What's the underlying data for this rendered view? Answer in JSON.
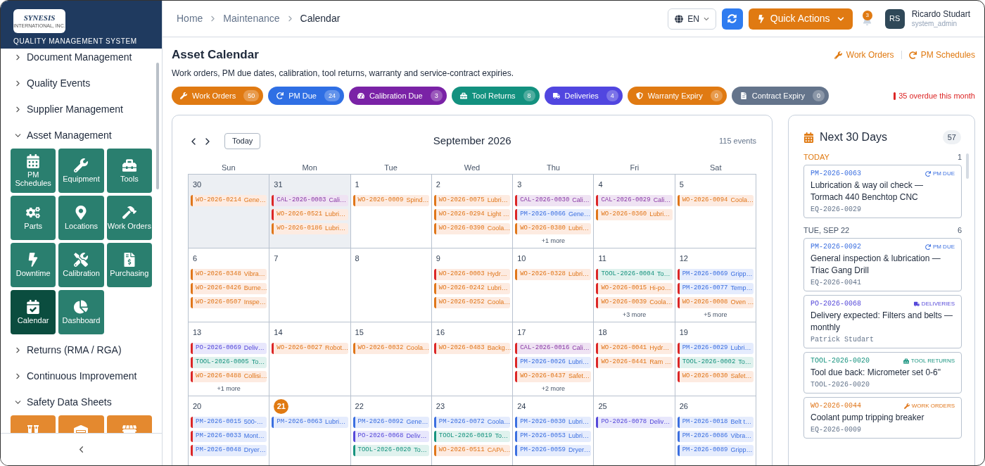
{
  "sidebar": {
    "logo_text": "SYNESIS",
    "logo_subtext": "INTERNATIONAL, INC.",
    "app_title": "QUALITY MANAGEMENT SYSTEM",
    "nav": [
      {
        "label": "Document Management",
        "expanded": false
      },
      {
        "label": "Quality Events",
        "expanded": false
      },
      {
        "label": "Supplier Management",
        "expanded": false
      },
      {
        "label": "Asset Management",
        "expanded": true,
        "tiles": [
          {
            "label": "PM Schedules",
            "selected": false
          },
          {
            "label": "Equipment",
            "selected": false
          },
          {
            "label": "Tools",
            "selected": false
          },
          {
            "label": "Parts",
            "selected": false
          },
          {
            "label": "Locations",
            "selected": false
          },
          {
            "label": "Work Orders",
            "selected": false
          },
          {
            "label": "Downtime",
            "selected": false
          },
          {
            "label": "Calibration",
            "selected": false
          },
          {
            "label": "Purchasing",
            "selected": false
          },
          {
            "label": "Calendar",
            "selected": true
          },
          {
            "label": "Dashboard",
            "selected": false
          }
        ]
      },
      {
        "label": "Returns (RMA / RGA)",
        "expanded": false
      },
      {
        "label": "Continuous Improvement",
        "expanded": false
      },
      {
        "label": "Safety Data Sheets",
        "expanded": true,
        "tiles": [
          {
            "selected": false
          },
          {
            "selected": false
          },
          {
            "selected": false
          }
        ]
      }
    ]
  },
  "topbar": {
    "breadcrumb": [
      "Home",
      "Maintenance",
      "Calendar"
    ],
    "language": "EN",
    "quick_actions": "Quick Actions",
    "notifications": "3",
    "user": {
      "initials": "RS",
      "name": "Ricardo Studart",
      "role": "system_admin"
    }
  },
  "page": {
    "title": "Asset Calendar",
    "description": "Work orders, PM due dates, calibration, tool returns, warranty and service-contract expiries.",
    "links": [
      "Work Orders",
      "PM Schedules"
    ],
    "filters": [
      {
        "label": "Work Orders",
        "count": "50",
        "color": "#e07a12"
      },
      {
        "label": "PM Due",
        "count": "24",
        "color": "#2f6fe4"
      },
      {
        "label": "Calibration Due",
        "count": "3",
        "color": "#7a22a6"
      },
      {
        "label": "Tool Returns",
        "count": "8",
        "color": "#13917f"
      },
      {
        "label": "Deliveries",
        "count": "4",
        "color": "#5146e0"
      },
      {
        "label": "Warranty Expiry",
        "count": "0",
        "color": "#e07a12"
      },
      {
        "label": "Contract Expiry",
        "count": "0",
        "color": "#64748b"
      }
    ],
    "overdue": "35 overdue this month"
  },
  "calendar": {
    "today_button": "Today",
    "month": "September 2026",
    "event_count": "115 events",
    "weekdays": [
      "Sun",
      "Mon",
      "Tue",
      "Wed",
      "Thu",
      "Fri",
      "Sat"
    ],
    "weeks": [
      {
        "days": [
          {
            "day": "30",
            "outside_month": true,
            "today": false,
            "events": [
              {
                "code": "WO-2026-0214",
                "title": "Gene…",
                "kind": "wo",
                "overdue": false
              }
            ]
          },
          {
            "day": "31",
            "outside_month": true,
            "today": false,
            "events": [
              {
                "code": "CAL-2026-0003",
                "title": "Cali…",
                "kind": "cal",
                "overdue": true
              },
              {
                "code": "WO-2026-0521",
                "title": "Lubri…",
                "kind": "wo",
                "overdue": true
              },
              {
                "code": "WO-2026-0186",
                "title": "Lubri…",
                "kind": "wo",
                "overdue": false
              }
            ]
          },
          {
            "day": "1",
            "outside_month": false,
            "today": false,
            "events": [
              {
                "code": "WO-2026-0009",
                "title": "Spind…",
                "kind": "wo",
                "overdue": false
              }
            ]
          },
          {
            "day": "2",
            "outside_month": false,
            "today": false,
            "events": [
              {
                "code": "WO-2026-0075",
                "title": "Lubri…",
                "kind": "wo",
                "overdue": false
              },
              {
                "code": "WO-2026-0294",
                "title": "Light …",
                "kind": "wo",
                "overdue": false
              },
              {
                "code": "WO-2026-0390",
                "title": "Coola…",
                "kind": "wo",
                "overdue": false
              }
            ]
          },
          {
            "day": "3",
            "outside_month": false,
            "today": false,
            "events": [
              {
                "code": "CAL-2026-0030",
                "title": "Cali…",
                "kind": "cal",
                "overdue": true
              },
              {
                "code": "PM-2026-0066",
                "title": "Gene…",
                "kind": "pm",
                "overdue": true
              },
              {
                "code": "WO-2026-0380",
                "title": "Lubri…",
                "kind": "wo",
                "overdue": false
              }
            ],
            "more": "+1 more"
          },
          {
            "day": "4",
            "outside_month": false,
            "today": false,
            "events": [
              {
                "code": "CAL-2026-0029",
                "title": "Cali…",
                "kind": "cal",
                "overdue": true
              },
              {
                "code": "WO-2026-0360",
                "title": "Lubri…",
                "kind": "wo",
                "overdue": false
              }
            ]
          },
          {
            "day": "5",
            "outside_month": false,
            "today": false,
            "events": [
              {
                "code": "WO-2026-0094",
                "title": "Coola…",
                "kind": "wo",
                "overdue": false
              }
            ]
          }
        ]
      },
      {
        "days": [
          {
            "day": "6",
            "outside_month": false,
            "today": false,
            "events": [
              {
                "code": "WO-2026-0348",
                "title": "Vibra…",
                "kind": "wo",
                "overdue": false
              },
              {
                "code": "WO-2026-0426",
                "title": "Burne…",
                "kind": "wo",
                "overdue": false
              },
              {
                "code": "WO-2026-0507",
                "title": "Inspe…",
                "kind": "wo",
                "overdue": false
              }
            ]
          },
          {
            "day": "7",
            "outside_month": false,
            "today": false
          },
          {
            "day": "8",
            "outside_month": false,
            "today": false
          },
          {
            "day": "9",
            "outside_month": false,
            "today": false,
            "events": [
              {
                "code": "WO-2026-0003",
                "title": "Hydr…",
                "kind": "wo",
                "overdue": true
              },
              {
                "code": "WO-2026-0242",
                "title": "Lubri…",
                "kind": "wo",
                "overdue": false
              },
              {
                "code": "WO-2026-0252",
                "title": "Coola…",
                "kind": "wo",
                "overdue": false
              }
            ]
          },
          {
            "day": "10",
            "outside_month": false,
            "today": false,
            "events": [
              {
                "code": "WO-2026-0328",
                "title": "Lubri…",
                "kind": "wo",
                "overdue": false
              }
            ]
          },
          {
            "day": "11",
            "outside_month": false,
            "today": false,
            "events": [
              {
                "code": "TOOL-2026-0004",
                "title": "To…",
                "kind": "tool",
                "overdue": true
              },
              {
                "code": "WO-2026-0015",
                "title": "Hi-po…",
                "kind": "wo",
                "overdue": true
              },
              {
                "code": "WO-2026-0039",
                "title": "Coola…",
                "kind": "wo",
                "overdue": true
              }
            ],
            "more": "+3 more"
          },
          {
            "day": "12",
            "outside_month": false,
            "today": false,
            "events": [
              {
                "code": "PM-2026-0069",
                "title": "Gripp…",
                "kind": "pm",
                "overdue": true
              },
              {
                "code": "PM-2026-0077",
                "title": "Temp…",
                "kind": "pm",
                "overdue": true
              },
              {
                "code": "WO-2026-0008",
                "title": "Oven …",
                "kind": "wo",
                "overdue": true
              }
            ],
            "more": "+5 more"
          }
        ]
      },
      {
        "days": [
          {
            "day": "13",
            "outside_month": false,
            "today": false,
            "events": [
              {
                "code": "PO-2026-0069",
                "title": "Deliv…",
                "kind": "po",
                "overdue": true
              },
              {
                "code": "TOOL-2026-0005",
                "title": "To…",
                "kind": "tool",
                "overdue": true
              },
              {
                "code": "WO-2026-0488",
                "title": "Collisi…",
                "kind": "wo",
                "overdue": true
              }
            ],
            "more": "+1 more"
          },
          {
            "day": "14",
            "outside_month": false,
            "today": false,
            "events": [
              {
                "code": "WO-2026-0027",
                "title": "Robot…",
                "kind": "wo",
                "overdue": true
              }
            ]
          },
          {
            "day": "15",
            "outside_month": false,
            "today": false,
            "events": [
              {
                "code": "WO-2026-0032",
                "title": "Coola…",
                "kind": "wo",
                "overdue": false
              }
            ]
          },
          {
            "day": "16",
            "outside_month": false,
            "today": false,
            "events": [
              {
                "code": "WO-2026-0483",
                "title": "Backg…",
                "kind": "wo",
                "overdue": true
              }
            ]
          },
          {
            "day": "17",
            "outside_month": false,
            "today": false,
            "events": [
              {
                "code": "CAL-2026-0016",
                "title": "Cali…",
                "kind": "cal",
                "overdue": true
              },
              {
                "code": "PM-2026-0026",
                "title": "Lubri…",
                "kind": "pm",
                "overdue": true
              },
              {
                "code": "WO-2026-0437",
                "title": "Safet…",
                "kind": "wo",
                "overdue": true
              }
            ],
            "more": "+2 more"
          },
          {
            "day": "18",
            "outside_month": false,
            "today": false,
            "events": [
              {
                "code": "WO-2026-0041",
                "title": "Hydr…",
                "kind": "wo",
                "overdue": true
              },
              {
                "code": "WO-2026-0441",
                "title": "Ram …",
                "kind": "wo",
                "overdue": true
              }
            ]
          },
          {
            "day": "19",
            "outside_month": false,
            "today": false,
            "events": [
              {
                "code": "PM-2026-0029",
                "title": "Lubri…",
                "kind": "pm",
                "overdue": true
              },
              {
                "code": "TOOL-2026-0002",
                "title": "To…",
                "kind": "tool",
                "overdue": true
              },
              {
                "code": "WO-2026-0030",
                "title": "Safet…",
                "kind": "wo",
                "overdue": true
              }
            ]
          }
        ]
      },
      {
        "days": [
          {
            "day": "20",
            "outside_month": false,
            "today": false,
            "events": [
              {
                "code": "PM-2026-0015",
                "title": "500-…",
                "kind": "pm",
                "overdue": true
              },
              {
                "code": "PM-2026-0033",
                "title": "Mont…",
                "kind": "pm",
                "overdue": true
              },
              {
                "code": "PM-2026-0048",
                "title": "Dryer…",
                "kind": "pm",
                "overdue": true
              }
            ]
          },
          {
            "day": "21",
            "outside_month": false,
            "today": true,
            "events": [
              {
                "code": "PM-2026-0063",
                "title": "Lubri…",
                "kind": "pm",
                "overdue": false
              }
            ]
          },
          {
            "day": "22",
            "outside_month": false,
            "today": false,
            "events": [
              {
                "code": "PM-2026-0092",
                "title": "Gene…",
                "kind": "pm",
                "overdue": false
              },
              {
                "code": "PO-2026-0068",
                "title": "Deliv…",
                "kind": "po",
                "overdue": false
              },
              {
                "code": "TOOL-2026-0020",
                "title": "To…",
                "kind": "tool",
                "overdue": false
              }
            ]
          },
          {
            "day": "23",
            "outside_month": false,
            "today": false,
            "events": [
              {
                "code": "PM-2026-0072",
                "title": "Coola…",
                "kind": "pm",
                "overdue": false
              },
              {
                "code": "TOOL-2026-0019",
                "title": "To…",
                "kind": "tool",
                "overdue": false
              },
              {
                "code": "WO-2026-0511",
                "title": "CAPA…",
                "kind": "wo",
                "overdue": false
              }
            ]
          },
          {
            "day": "24",
            "outside_month": false,
            "today": false,
            "events": [
              {
                "code": "PM-2026-0030",
                "title": "Lubri…",
                "kind": "pm",
                "overdue": false
              },
              {
                "code": "PM-2026-0053",
                "title": "Lubri…",
                "kind": "pm",
                "overdue": false
              },
              {
                "code": "PM-2026-0059",
                "title": "Dryer…",
                "kind": "pm",
                "overdue": false
              }
            ]
          },
          {
            "day": "25",
            "outside_month": false,
            "today": false,
            "events": [
              {
                "code": "PO-2026-0078",
                "title": "Deliv…",
                "kind": "po",
                "overdue": false
              }
            ]
          },
          {
            "day": "26",
            "outside_month": false,
            "today": false,
            "events": [
              {
                "code": "PM-2026-0018",
                "title": "Belt t…",
                "kind": "pm",
                "overdue": false
              },
              {
                "code": "PM-2026-0086",
                "title": "Vibra…",
                "kind": "pm",
                "overdue": false
              },
              {
                "code": "PM-2026-0089",
                "title": "Gripp…",
                "kind": "pm",
                "overdue": false
              }
            ]
          }
        ]
      }
    ]
  },
  "upcoming": {
    "title": "Next 30 Days",
    "count": "57",
    "groups": [
      {
        "label": "TODAY",
        "today": true,
        "count": "1",
        "items": [
          {
            "code": "PM-2026-0063",
            "kind": "pm",
            "tag": "PM DUE",
            "title": "Lubrication & way oil check — Tormach 440 Benchtop CNC",
            "meta": "EQ-2026-0029"
          }
        ]
      },
      {
        "label": "TUE, SEP 22",
        "today": false,
        "count": "6",
        "items": [
          {
            "code": "PM-2026-0092",
            "kind": "pm",
            "tag": "PM DUE",
            "title": "General inspection & lubrication — Triac Gang Drill",
            "meta": "EQ-2026-0041"
          },
          {
            "code": "PO-2026-0068",
            "kind": "po",
            "tag": "DELIVERIES",
            "title": "Delivery expected: Filters and belts — monthly",
            "meta": "Patrick Studart"
          },
          {
            "code": "TOOL-2026-0020",
            "kind": "tool",
            "tag": "TOOL RETURNS",
            "title": "Tool due back: Micrometer set 0-6\"",
            "meta": "TOOL-2026-0020"
          },
          {
            "code": "WO-2026-0044",
            "kind": "wo",
            "tag": "WORK ORDERS",
            "title": "Coolant pump tripping breaker",
            "meta": "EQ-2026-0009"
          }
        ]
      }
    ]
  }
}
